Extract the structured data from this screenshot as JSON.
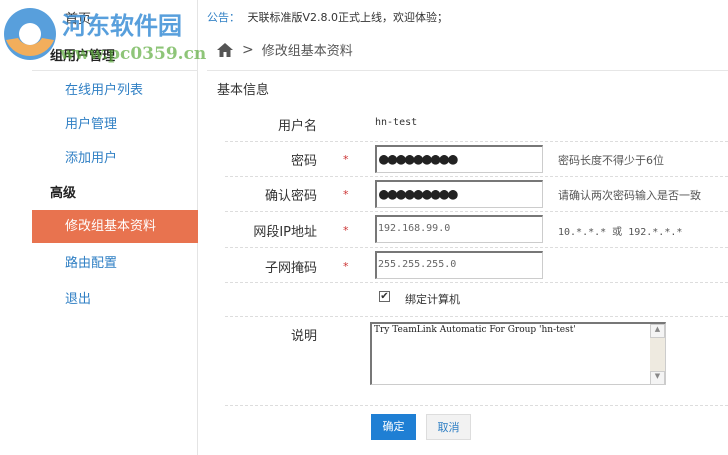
{
  "watermark": {
    "title": "河东软件园",
    "url": "www.pc0359.cn"
  },
  "sidebar": {
    "home": "首页",
    "group_header": "组用户管理",
    "items": [
      "在线用户列表",
      "用户管理",
      "添加用户"
    ],
    "advanced_header": "高级",
    "active_item": "修改组基本资料",
    "route": "路由配置",
    "logout": "退出"
  },
  "notice": {
    "label": "公告：",
    "text": "天联标准版V2.8.0正式上线，欢迎体验；"
  },
  "breadcrumb": {
    "icon": "home-icon",
    "separator": ">",
    "current": "修改组基本资料"
  },
  "section_title": "基本信息",
  "form": {
    "username": {
      "label": "用户名",
      "value": "hn-test"
    },
    "password": {
      "label": "密码",
      "required": "*",
      "value": "●●●●●●●●●",
      "hint": "密码长度不得少于6位"
    },
    "confirm_password": {
      "label": "确认密码",
      "required": "*",
      "value": "●●●●●●●●●",
      "hint": "请确认两次密码输入是否一致"
    },
    "ip": {
      "label": "网段IP地址",
      "required": "*",
      "value": "192.168.99.0",
      "hint": "10.*.*.* 或 192.*.*.*"
    },
    "mask": {
      "label": "子网掩码",
      "required": "*",
      "value": "255.255.255.0"
    },
    "bind": {
      "label": "绑定计算机",
      "checked": true,
      "mark": "✔"
    },
    "description": {
      "label": "说明",
      "value": "Try TeamLink Automatic For Group 'hn-test'"
    }
  },
  "buttons": {
    "confirm": "确定",
    "cancel": "取消"
  },
  "colors": {
    "accent": "#e8734f",
    "link": "#2f7fc4",
    "primary_button": "#1f7fd4"
  }
}
